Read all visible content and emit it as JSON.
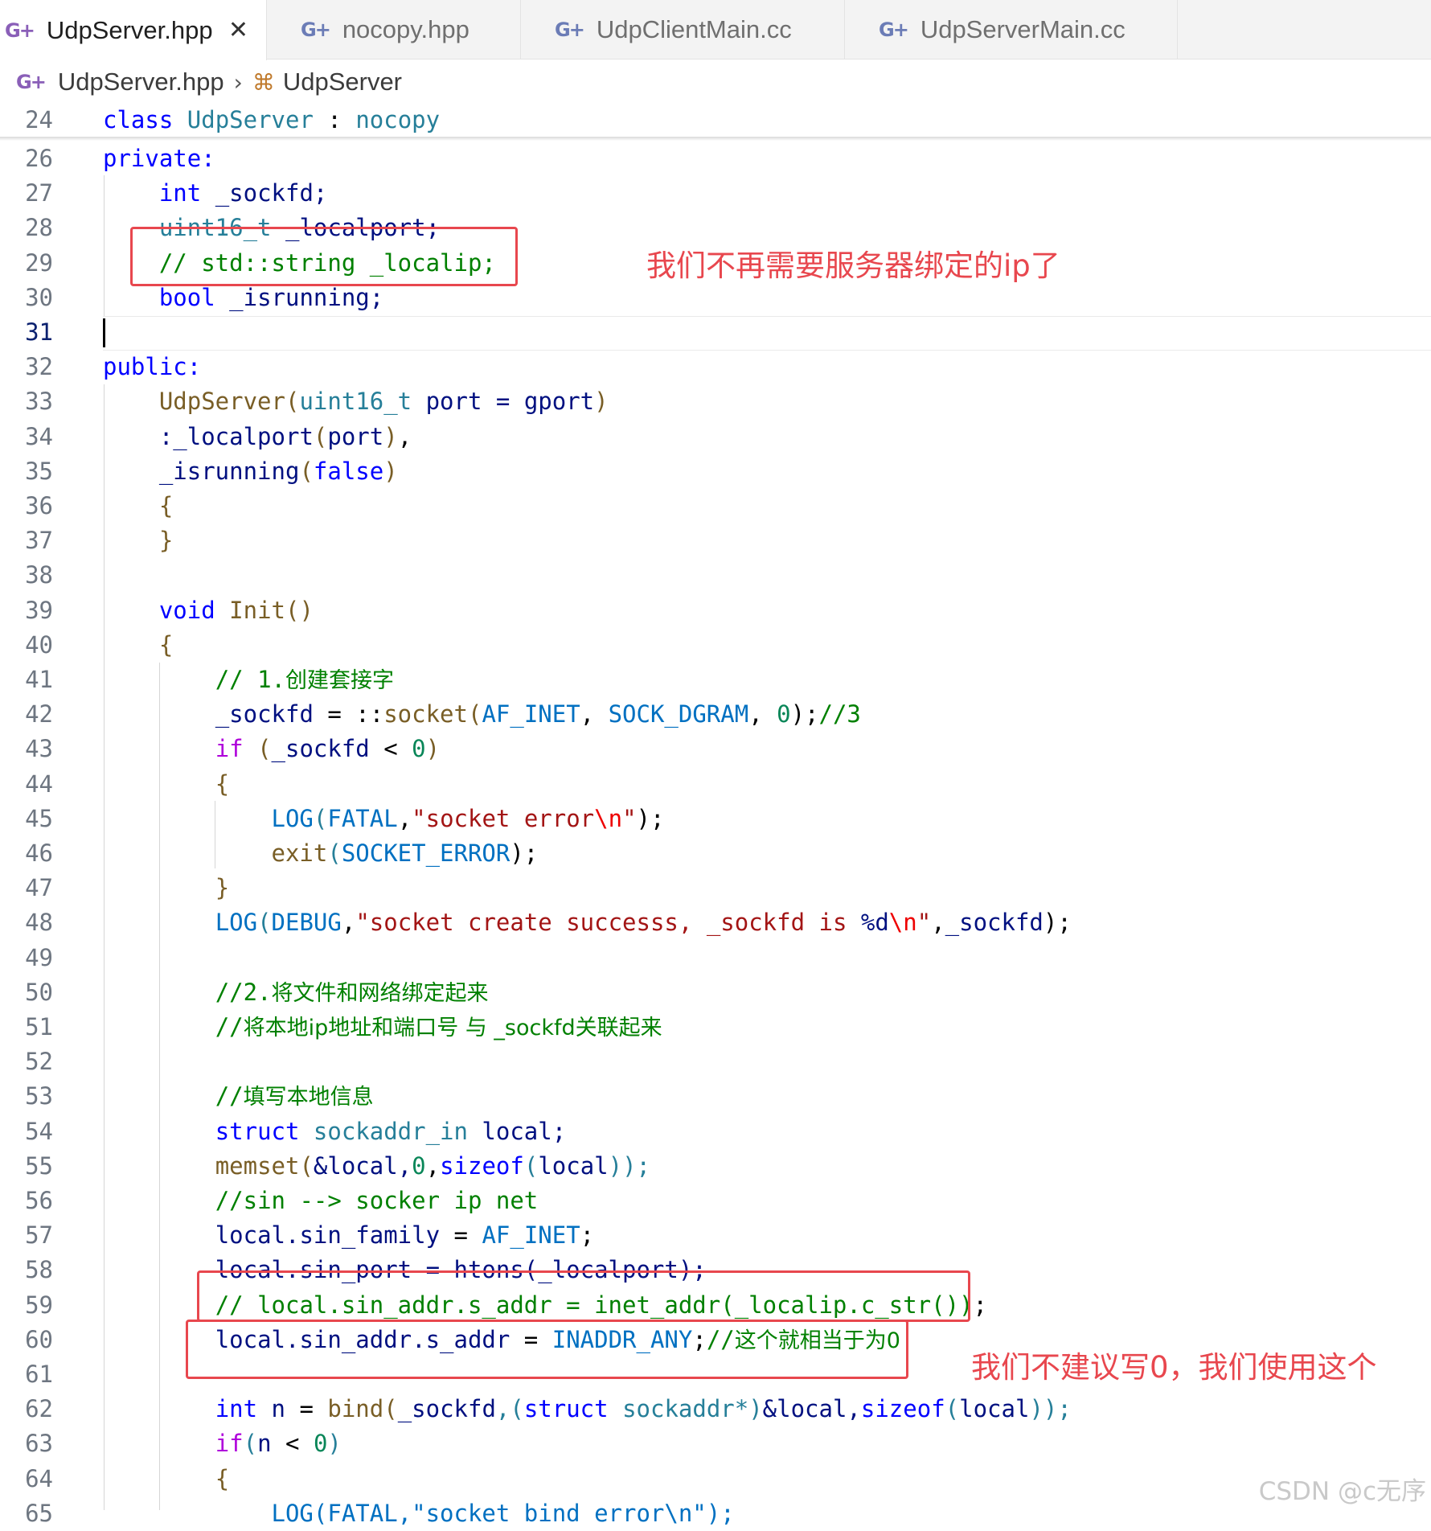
{
  "tabs": [
    {
      "label": "UdpServer.hpp",
      "active": true,
      "icon": "cpp-file-icon"
    },
    {
      "label": "nocopy.hpp",
      "icon": "cpp-file-icon"
    },
    {
      "label": "UdpClientMain.cc",
      "icon": "cpp-file-icon"
    },
    {
      "label": "UdpServerMain.cc",
      "icon": "cpp-file-icon"
    }
  ],
  "tab_close_glyph": "✕",
  "breadcrumb": {
    "file": "UdpServer.hpp",
    "symbol": "UdpServer"
  },
  "line_numbers": [
    "24",
    "26",
    "27",
    "28",
    "29",
    "30",
    "31",
    "32",
    "33",
    "34",
    "35",
    "36",
    "37",
    "38",
    "39",
    "40",
    "41",
    "42",
    "43",
    "44",
    "45",
    "46",
    "47",
    "48",
    "49",
    "50",
    "51",
    "52",
    "53",
    "54",
    "55",
    "56",
    "57",
    "58",
    "59",
    "60",
    "61",
    "62",
    "63",
    "64",
    "65"
  ],
  "code": {
    "l24": {
      "a": "class",
      "b": "UdpServer",
      "c": " : ",
      "d": "nocopy"
    },
    "l26": {
      "a": "private:"
    },
    "l27": {
      "a": "int",
      "b": " _sockfd;"
    },
    "l28": {
      "a": "uint16_t",
      "b": " _localport;"
    },
    "l29": {
      "a": "// std::string _localip;"
    },
    "l30": {
      "a": "bool",
      "b": " _isrunning;"
    },
    "l32": {
      "a": "public:"
    },
    "l33": {
      "a": "UdpServer",
      "b": "(",
      "c": "uint16_t",
      "d": " port = gport",
      "e": ")"
    },
    "l34": {
      "a": ":_localport",
      "b": "(",
      "c": "port",
      "d": ")",
      "e": ","
    },
    "l35": {
      "a": "_isrunning",
      "b": "(",
      "c": "false",
      "d": ")"
    },
    "l36": {
      "a": "{"
    },
    "l37": {
      "a": "}"
    },
    "l39": {
      "a": "void",
      "b": " Init",
      "c": "()"
    },
    "l40": {
      "a": "{"
    },
    "l41": {
      "a": "// 1.",
      "b": "创建套接字"
    },
    "l42": {
      "a": "_sockfd",
      "b": " = ::",
      "c": "socket",
      "d": "(",
      "e": "AF_INET",
      "f": ", ",
      "g": "SOCK_DGRAM",
      "h": ", ",
      "i": "0",
      "j": ");",
      "k": "//3"
    },
    "l43": {
      "a": "if",
      "b": " (",
      "c": "_sockfd",
      "d": " < ",
      "e": "0",
      "f": ")"
    },
    "l44": {
      "a": "{"
    },
    "l45": {
      "a": "LOG",
      "b": "(",
      "c": "FATAL",
      "d": ",",
      "e": "\"socket error",
      "f": "\\n",
      "g": "\"",
      "h": ");"
    },
    "l46": {
      "a": "exit",
      "b": "(",
      "c": "SOCKET_ERROR",
      "d": ");"
    },
    "l47": {
      "a": "}"
    },
    "l48": {
      "a": "LOG",
      "b": "(",
      "c": "DEBUG",
      "d": ",",
      "e": "\"socket create successs, _sockfd is ",
      "f": "%d",
      "g": "\\n",
      "h": "\"",
      "i": ",",
      "j": "_sockfd",
      "k": ");"
    },
    "l50": {
      "a": "//2.",
      "b": "将文件和网络绑定起来"
    },
    "l51": {
      "a": "//",
      "b": "将本地ip地址和端口号 与 _sockfd关联起来"
    },
    "l53": {
      "a": "//",
      "b": "填写本地信息"
    },
    "l54": {
      "a": "struct",
      "b": " sockaddr_in",
      "c": " local;"
    },
    "l55": {
      "a": "memset",
      "b": "(",
      "c": "&local,",
      "d": "0",
      "e": ",",
      "f": "sizeof",
      "g": "(",
      "h": "local",
      "i": "));"
    },
    "l56": {
      "a": "//sin --> socker ip net"
    },
    "l57": {
      "a": "local.sin_family",
      "b": " = ",
      "c": "AF_INET",
      "d": ";"
    },
    "l58": {
      "a": "local.sin_port = htons(_localport);"
    },
    "l59": {
      "a": "// local.sin_addr.s_addr = inet_addr(_localip.c_str())",
      "b": ";"
    },
    "l60": {
      "a": "local.sin_addr.s_addr",
      "b": " = ",
      "c": "INADDR_ANY",
      "d": ";",
      "e": "//",
      "f": "这个就相当于为0"
    },
    "l62": {
      "a": "int",
      "b": " n",
      "c": " = ",
      "d": "bind",
      "e": "(",
      "f": "_sockfd",
      "g": ",(",
      "h": "struct",
      "i": " sockaddr",
      "j": "*)",
      "k": "&local,",
      "l": "sizeof",
      "m": "(",
      "n": "local",
      "o": "));"
    },
    "l63": {
      "a": "if",
      "b": "(",
      "c": "n",
      "d": " < ",
      "e": "0",
      "f": ")"
    },
    "l64": {
      "a": "{"
    },
    "l65": {
      "a": "LOG(FATAL,\"socket bind error\\n\");"
    }
  },
  "annotations": {
    "note1": "我们不再需要服务器绑定的ip了",
    "note2": "我们不建议写0，我们使用这个"
  },
  "watermark": "CSDN @c无序",
  "colors": {
    "annotation": "#e8474e",
    "keyword": "#0000ff",
    "type": "#267f99",
    "function": "#795e26",
    "comment": "#008000",
    "string": "#a31515"
  }
}
